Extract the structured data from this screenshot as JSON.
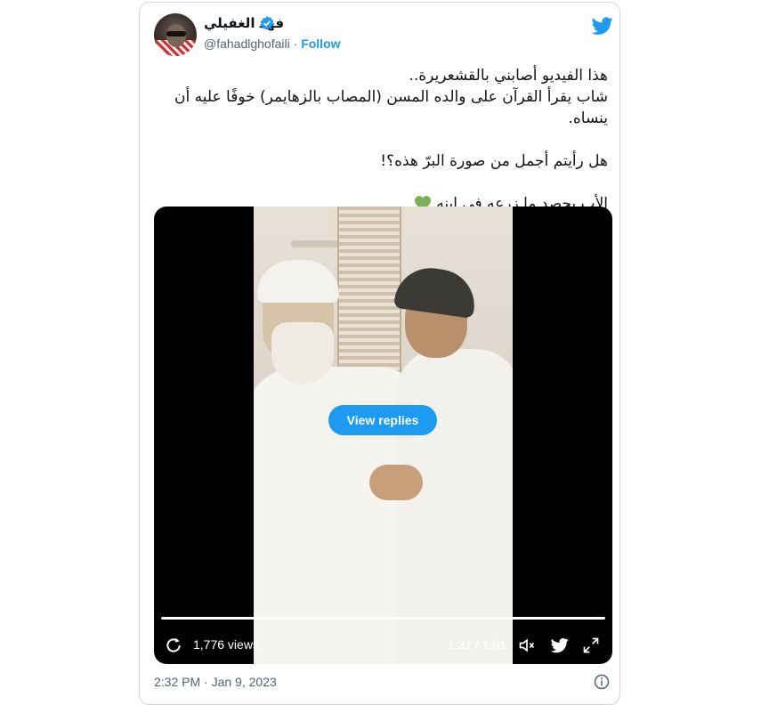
{
  "author": {
    "name": "فهد الغفيلي",
    "handle": "@fahadlghofaili",
    "follow_label": "Follow"
  },
  "tweet": {
    "lines": [
      "هذا الفيديو أصابني بالقشعريرة..",
      "شاب يقرأ القرآن على والده المسن (المصاب بالزهايمر) خوفًا عليه أن ينساه.",
      "هل رأيتم أجمل من صورة البرّ هذه؟!",
      "الأب يحصد ما زرعه في ابنه"
    ],
    "emoji": "green-heart"
  },
  "video": {
    "overlay_button": "View replies",
    "views": "1,776 views",
    "time": "1:31 / 1:31",
    "progress": 1.0
  },
  "footer": {
    "timestamp": "2:32 PM · Jan 9, 2023"
  },
  "colors": {
    "accent": "#1d9bf0",
    "heart": "#78b159",
    "text": "#0f1419",
    "muted": "#536471"
  }
}
